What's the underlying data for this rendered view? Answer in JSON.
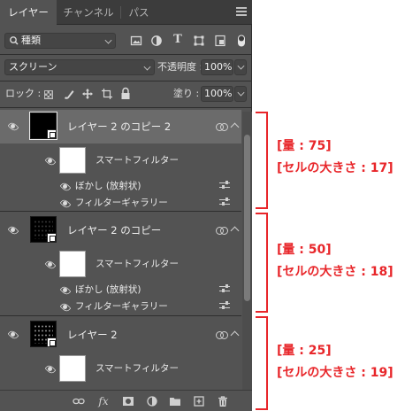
{
  "tabs": [
    {
      "label": "レイヤー",
      "active": true
    },
    {
      "label": "チャンネル",
      "active": false
    },
    {
      "label": "パス",
      "active": false
    }
  ],
  "filter": {
    "kind_label": "種類"
  },
  "blend": {
    "mode": "スクリーン",
    "opacity_label": "不透明度 :",
    "opacity_value": "100%"
  },
  "lock": {
    "label": "ロック :",
    "fill_label": "塗り :",
    "fill_value": "100%"
  },
  "layers": [
    {
      "name": "レイヤー 2 のコピー 2",
      "selected": true,
      "smart_filter_label": "スマートフィルター",
      "filters": [
        "ぼかし (放射状)",
        "フィルターギャラリー"
      ]
    },
    {
      "name": "レイヤー 2 のコピー",
      "selected": false,
      "smart_filter_label": "スマートフィルター",
      "filters": [
        "ぼかし (放射状)",
        "フィルターギャラリー"
      ]
    },
    {
      "name": "レイヤー 2",
      "selected": false,
      "smart_filter_label": "スマートフィルター",
      "filters": []
    }
  ],
  "annotations": [
    {
      "line1": "[量 : 75]",
      "line2": "[セルの大きさ : 17]"
    },
    {
      "line1": "[量 : 50]",
      "line2": "[セルの大きさ : 18]"
    },
    {
      "line1": "[量 : 25]",
      "line2": "[セルの大きさ : 19]"
    }
  ],
  "colors": {
    "panel": "#535353",
    "selected": "#6b6b6b",
    "annotation": "#e8262a"
  }
}
